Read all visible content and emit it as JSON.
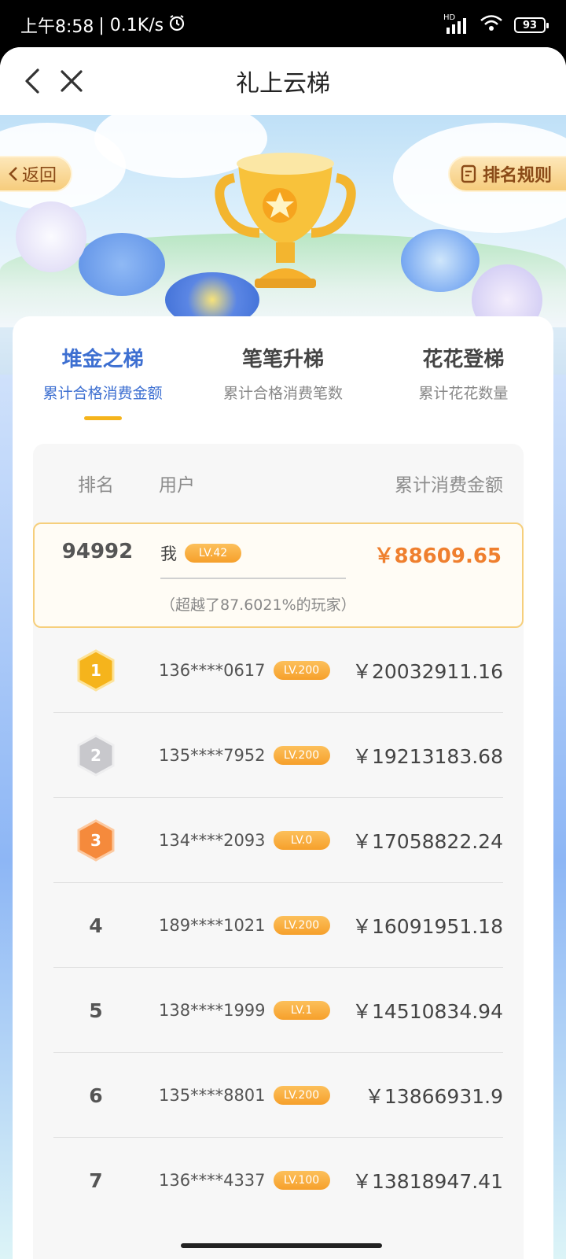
{
  "status_bar": {
    "time": "上午8:58",
    "net_speed": "| 0.1K/s",
    "network": "HD",
    "battery": "93"
  },
  "nav": {
    "title": "礼上云梯"
  },
  "banner": {
    "back_label": "返回",
    "rules_label": "排名规则"
  },
  "tabs": [
    {
      "title": "堆金之梯",
      "subtitle": "累计合格消费金额",
      "active": true
    },
    {
      "title": "笔笔升梯",
      "subtitle": "累计合格消费笔数",
      "active": false
    },
    {
      "title": "花花登梯",
      "subtitle": "累计花花数量",
      "active": false
    }
  ],
  "table": {
    "headers": {
      "rank": "排名",
      "user": "用户",
      "amount": "累计消费金额"
    },
    "me": {
      "rank": "94992",
      "name": "我",
      "level": "LV.42",
      "amount": "￥88609.65",
      "note": "（超越了87.6021%的玩家）"
    },
    "rows": [
      {
        "rank": "1",
        "user": "136****0617",
        "level": "LV.200",
        "amount": "￥20032911.16",
        "medal": "gold"
      },
      {
        "rank": "2",
        "user": "135****7952",
        "level": "LV.200",
        "amount": "￥19213183.68",
        "medal": "silver"
      },
      {
        "rank": "3",
        "user": "134****2093",
        "level": "LV.0",
        "amount": "￥17058822.24",
        "medal": "bronze"
      },
      {
        "rank": "4",
        "user": "189****1021",
        "level": "LV.200",
        "amount": "￥16091951.18"
      },
      {
        "rank": "5",
        "user": "138****1999",
        "level": "LV.1",
        "amount": "￥14510834.94"
      },
      {
        "rank": "6",
        "user": "135****8801",
        "level": "LV.200",
        "amount": "￥13866931.9"
      },
      {
        "rank": "7",
        "user": "136****4337",
        "level": "LV.100",
        "amount": "￥13818947.41"
      }
    ]
  },
  "colors": {
    "accent_blue": "#3d6fd1",
    "amount_orange": "#ef7f2e",
    "badge_orange": "#f6a02b",
    "gold": "#f5b41c",
    "silver": "#c8c8cc",
    "bronze": "#f58a3c"
  },
  "icons": [
    "back-chevron-icon",
    "close-x-icon",
    "alarm-clock-icon",
    "signal-icon",
    "wifi-icon",
    "battery-icon",
    "rules-doc-icon",
    "trophy-icon"
  ]
}
